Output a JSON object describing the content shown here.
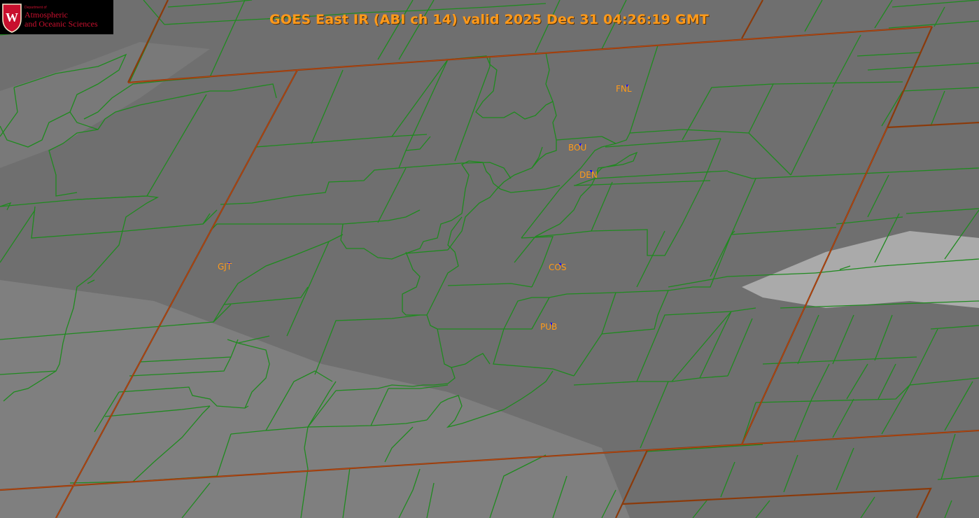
{
  "title": "GOES East IR (ABI ch 14) valid 2025 Dec 31 04:26:19 GMT",
  "logo": {
    "dept": "Department of",
    "line1": "Atmospheric",
    "line2": "and Oceanic Sciences",
    "crest_letter": "W"
  },
  "stations": [
    {
      "id": "FNL",
      "label": "FNL"
    },
    {
      "id": "BOU",
      "label": "BOU"
    },
    {
      "id": "DEN",
      "label": "DEN"
    },
    {
      "id": "GJT",
      "label": "GJT"
    },
    {
      "id": "COS",
      "label": "COS"
    },
    {
      "id": "PUB",
      "label": "PUB"
    }
  ],
  "colors": {
    "county_lines": "#1f8a1f",
    "state_lines": "#8b3a0a",
    "station_label": "#ff9a1a",
    "station_marker": "#1010ff",
    "title": "#ff9a1a",
    "logo_red": "#c8102e"
  }
}
